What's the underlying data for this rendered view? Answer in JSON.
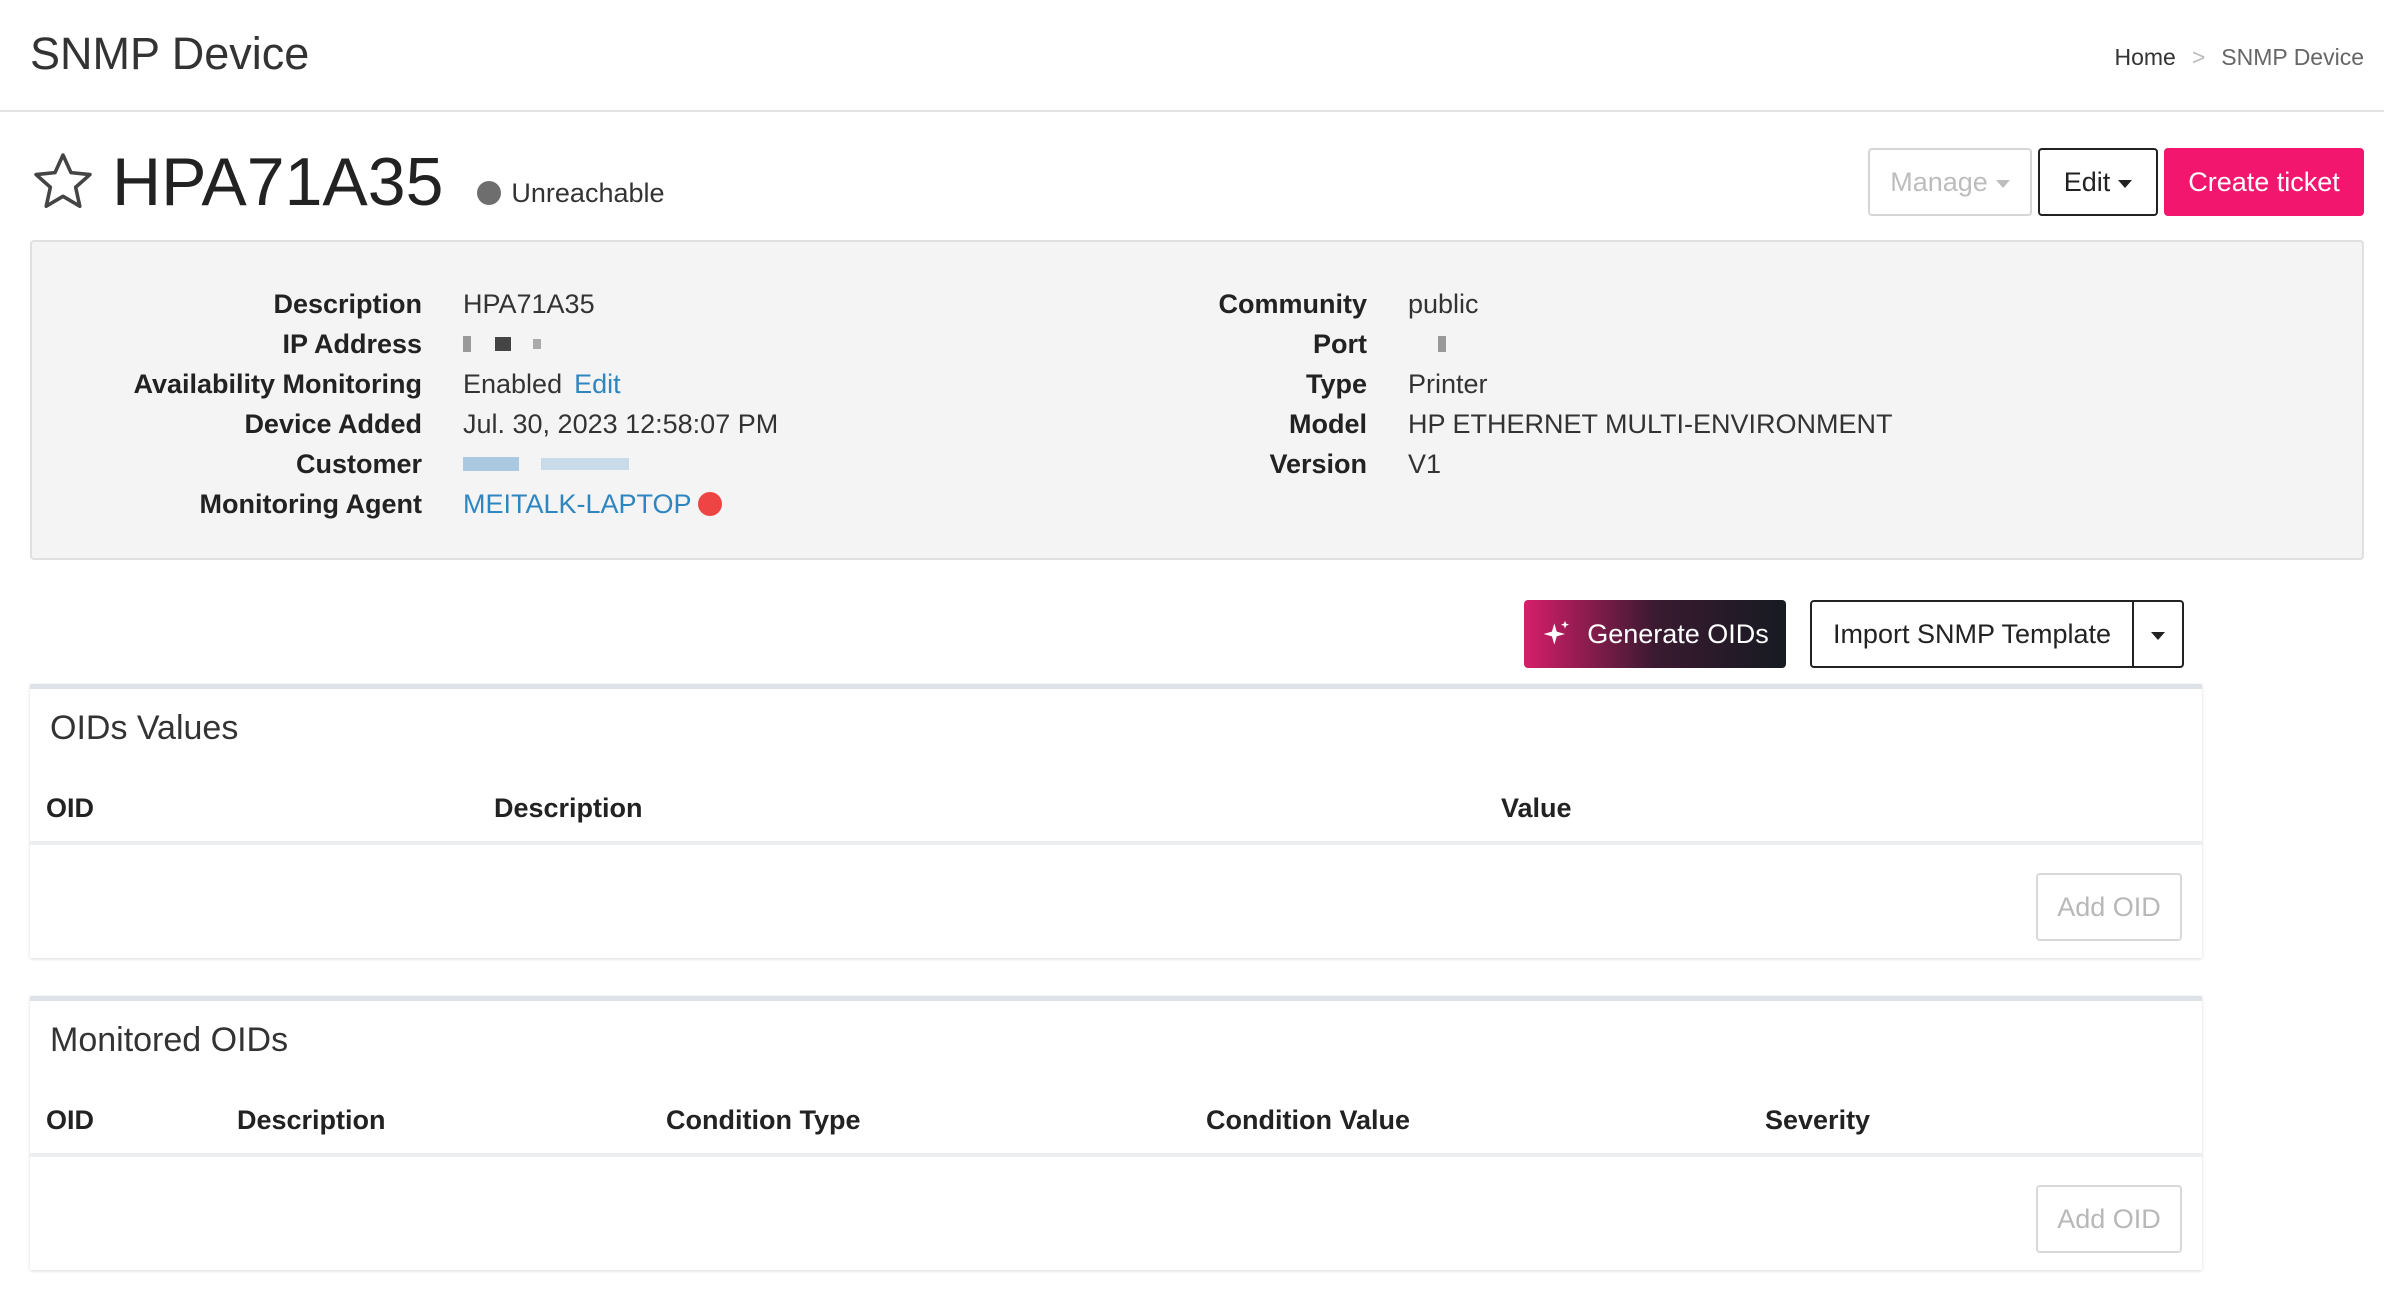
{
  "page": {
    "title": "SNMP Device",
    "breadcrumb": {
      "home": "Home",
      "separator": ">",
      "current": "SNMP Device"
    }
  },
  "device": {
    "name": "HPA71A35",
    "status": "Unreachable",
    "status_color": "#6e6e6e",
    "star_icon": "star-outline-icon"
  },
  "actions": {
    "manage": "Manage",
    "edit": "Edit",
    "create_ticket": "Create ticket",
    "accent": "#f2166f"
  },
  "details": {
    "left": {
      "description": {
        "label": "Description",
        "value": "HPA71A35"
      },
      "ip_address": {
        "label": "IP Address"
      },
      "availability": {
        "label": "Availability Monitoring",
        "value": "Enabled",
        "edit": "Edit"
      },
      "device_added": {
        "label": "Device Added",
        "value": "Jul. 30, 2023 12:58:07 PM"
      },
      "customer": {
        "label": "Customer"
      },
      "agent": {
        "label": "Monitoring Agent",
        "value": "MEITALK-LAPTOP",
        "status_color": "#ef4444"
      }
    },
    "right": {
      "community": {
        "label": "Community",
        "value": "public"
      },
      "port": {
        "label": "Port"
      },
      "type": {
        "label": "Type",
        "value": "Printer"
      },
      "model": {
        "label": "Model",
        "value": "HP ETHERNET MULTI-ENVIRONMENT"
      },
      "version": {
        "label": "Version",
        "value": "V1"
      }
    }
  },
  "toolbar": {
    "generate_oids": "Generate OIDs",
    "import_template": "Import SNMP Template"
  },
  "oids_values": {
    "title": "OIDs Values",
    "columns": [
      "OID",
      "Description",
      "Value"
    ],
    "add_label": "Add OID"
  },
  "monitored_oids": {
    "title": "Monitored OIDs",
    "columns": [
      "OID",
      "Description",
      "Condition Type",
      "Condition Value",
      "Severity"
    ],
    "add_label": "Add OID"
  }
}
